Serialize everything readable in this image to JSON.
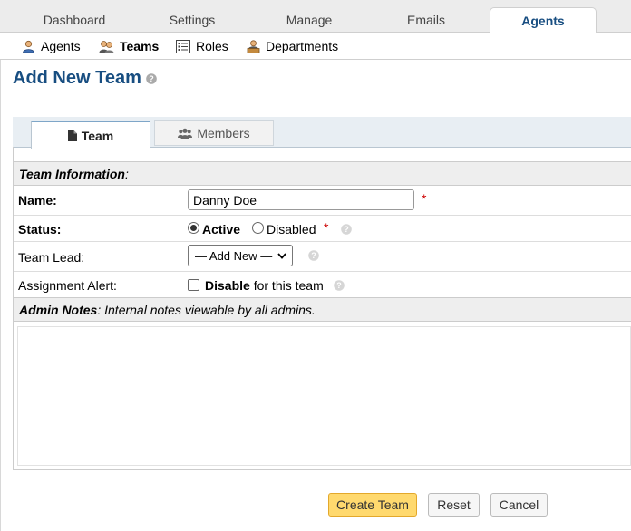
{
  "topnav": {
    "tabs": [
      {
        "label": "Dashboard"
      },
      {
        "label": "Settings"
      },
      {
        "label": "Manage"
      },
      {
        "label": "Emails"
      },
      {
        "label": "Agents"
      }
    ],
    "active": "Agents"
  },
  "subnav": {
    "items": [
      {
        "label": "Agents",
        "icon": "agent-icon"
      },
      {
        "label": "Teams",
        "icon": "teams-icon"
      },
      {
        "label": "Roles",
        "icon": "roles-icon"
      },
      {
        "label": "Departments",
        "icon": "departments-icon"
      }
    ],
    "active": "Teams"
  },
  "page": {
    "title": "Add New Team",
    "help_icon": "help-icon"
  },
  "form_tabs": [
    {
      "label": "Team",
      "icon": "file-icon"
    },
    {
      "label": "Members",
      "icon": "users-icon"
    }
  ],
  "team_info": {
    "heading": "Team Information",
    "heading_suffix": ":",
    "name_label": "Name:",
    "name_value": "Danny Doe",
    "status_label": "Status:",
    "status_active": "Active",
    "status_disabled": "Disabled",
    "status_selected": "Active",
    "team_lead_label": "Team Lead:",
    "team_lead_value": "— Add New —",
    "alert_label": "Assignment Alert:",
    "alert_strong": "Disable",
    "alert_rest": "for this team",
    "alert_checked": false,
    "required_mark": "*"
  },
  "admin_notes": {
    "heading": "Admin Notes",
    "description": ": Internal notes viewable by all admins.",
    "value": ""
  },
  "buttons": {
    "create": "Create Team",
    "reset": "Reset",
    "cancel": "Cancel"
  },
  "colors": {
    "brand": "#184e81",
    "primary_button": "#ffd96e",
    "required": "#cc0000"
  }
}
